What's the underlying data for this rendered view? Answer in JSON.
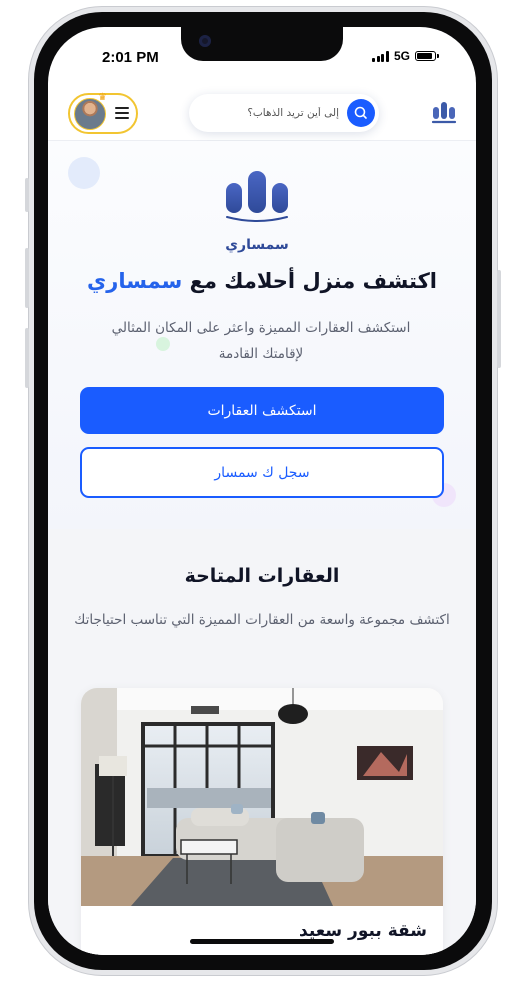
{
  "status_bar": {
    "time": "2:01 PM",
    "network": "5G",
    "battery_level": 0.9
  },
  "header": {
    "search_placeholder": "إلى أين تريد الذهاب؟",
    "icons": {
      "menu": "hamburger-menu-icon",
      "search": "search-icon",
      "brand": "simsari-logo-icon",
      "badge": "crown-icon"
    }
  },
  "hero": {
    "logo_text": "سمساري",
    "title_prefix": "اكتشف منزل أحلامك مع",
    "title_accent": "سمساري",
    "subtitle": "استكشف العقارات المميزة واعثر على المكان المثالي لإقامتك القادمة",
    "primary_button": "استكشف العقارات",
    "secondary_button": "سجل ك سمسار"
  },
  "properties": {
    "title": "العقارات المتاحة",
    "subtitle": "اكتشف مجموعة واسعة من العقارات المميزة التي تناسب احتياجاتك",
    "cards": [
      {
        "title": "شقة ببور سعيد"
      }
    ]
  },
  "colors": {
    "primary": "#1a5cff",
    "accent_text": "#2563eb",
    "logo": "#3c5aa8",
    "badge_border": "#f2c531"
  }
}
